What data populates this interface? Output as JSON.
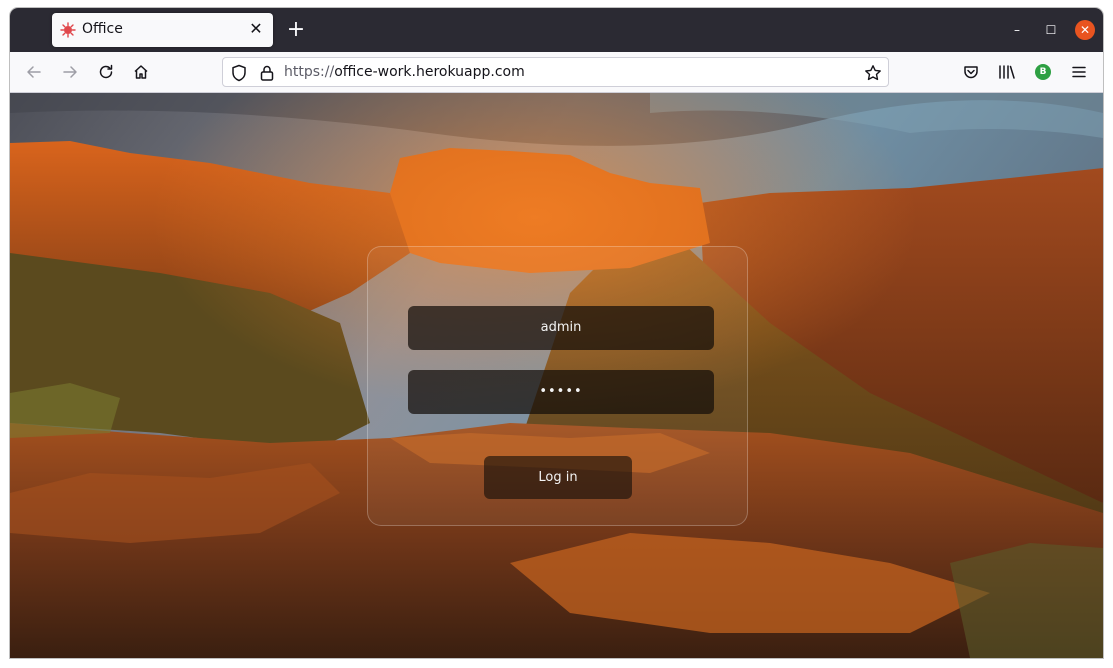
{
  "browser": {
    "tab": {
      "title": "Office",
      "favicon": "virus-icon",
      "favicon_color": "#e0474c"
    },
    "new_tab_label": "+",
    "window_controls": {
      "minimize": "–",
      "maximize": "☐",
      "close": "✕",
      "close_color": "#e95420"
    },
    "url": {
      "scheme": "https://",
      "host": "office-work.herokuapp.com"
    },
    "account_initial": "B",
    "account_color": "#2ea043",
    "toolbar_icons": [
      "back-arrow-icon",
      "forward-arrow-icon",
      "reload-icon",
      "home-icon",
      "shield-icon",
      "lock-icon",
      "star-icon",
      "pocket-icon",
      "library-icon",
      "account-icon",
      "hamburger-menu-icon"
    ]
  },
  "login": {
    "username_value": "admin",
    "password_value": "•••••",
    "submit_label": "Log in"
  },
  "background": {
    "description_icon": "landscape-photo",
    "sky_color": "#6f7b86",
    "rock_color": "#b5501c"
  }
}
